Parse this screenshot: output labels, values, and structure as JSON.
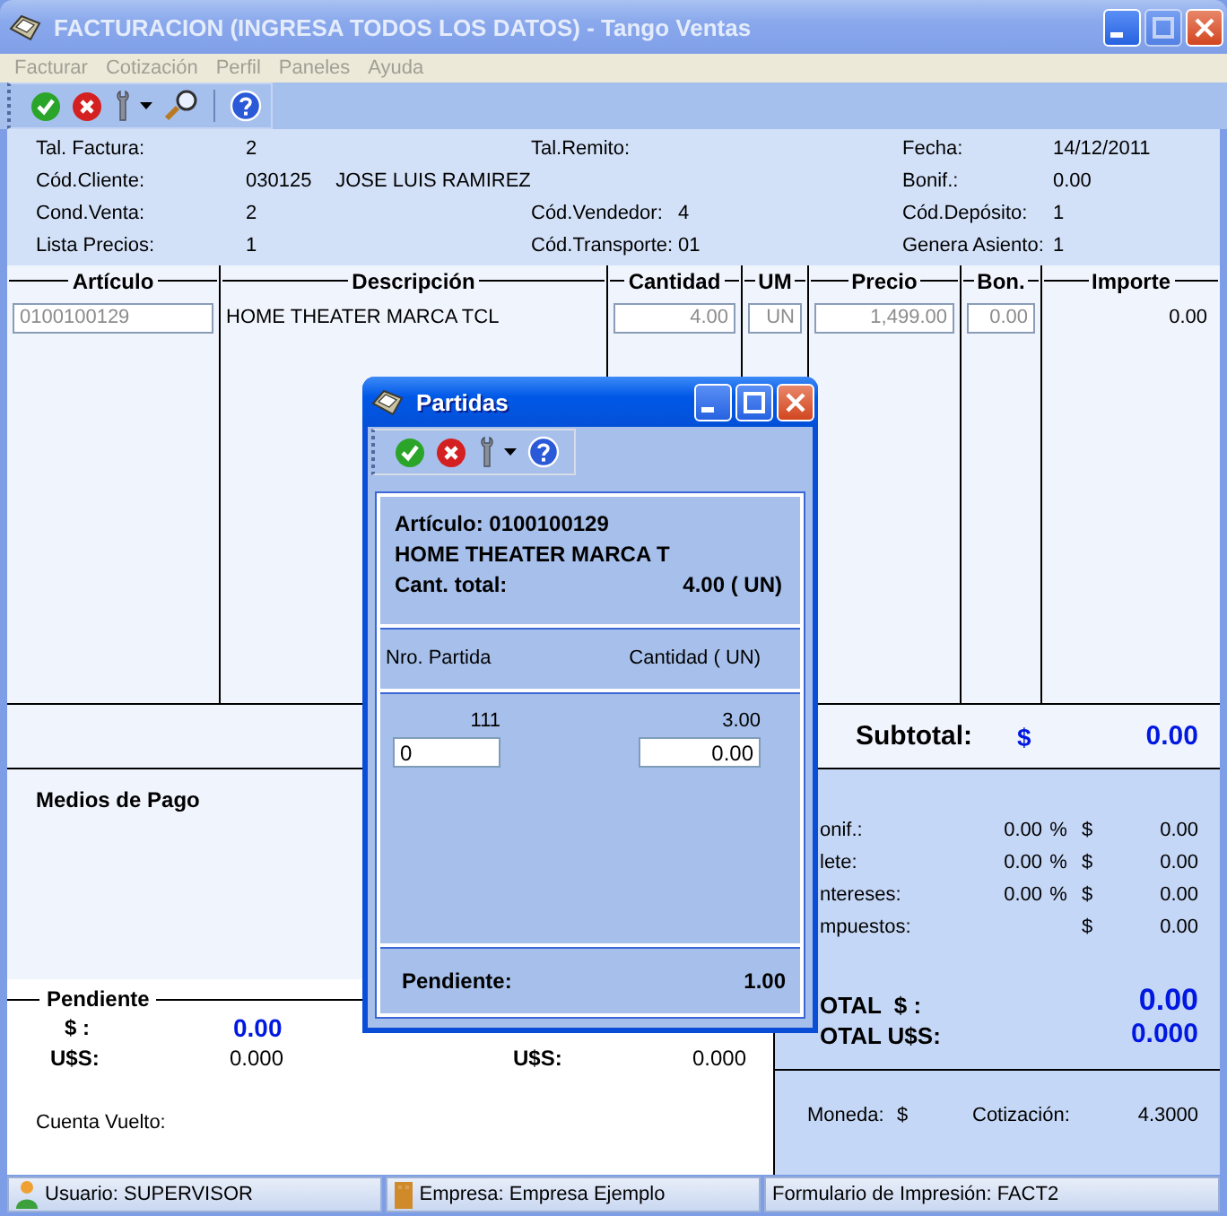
{
  "window": {
    "title": "FACTURACION (INGRESA TODOS LOS DATOS) - Tango Ventas",
    "active": false,
    "buttons": [
      {
        "kind": "minimize",
        "disabled": false
      },
      {
        "kind": "maximize",
        "disabled": true
      },
      {
        "kind": "close",
        "disabled": false
      }
    ]
  },
  "menu": [
    {
      "label": "Facturar",
      "disabled": true
    },
    {
      "label": "Cotización",
      "disabled": true
    },
    {
      "label": "Perfil",
      "disabled": true
    },
    {
      "label": "Paneles",
      "disabled": true
    },
    {
      "label": "Ayuda",
      "disabled": true
    }
  ],
  "header": {
    "rows": [
      [
        {
          "label": "Tal. Factura:",
          "value": "2"
        },
        {
          "label": "Tal.Remito:"
        },
        {
          "label": "Fecha:",
          "value": "14/12/2011"
        }
      ],
      [
        {
          "label": "Cód.Cliente:",
          "value": "030125",
          "extra": "JOSE LUIS RAMIREZ"
        },
        null,
        {
          "label": "Bonif.:",
          "value": "0.00"
        }
      ],
      [
        {
          "label": "Cond.Venta:",
          "value": "2"
        },
        {
          "label": "Cód.Vendedor:",
          "value": "4"
        },
        {
          "label": "Cód.Depósito:",
          "value": "1"
        }
      ],
      [
        {
          "label": "Lista Precios:",
          "value": "1"
        },
        {
          "label": "Cód.Transporte:",
          "value": "01"
        },
        {
          "label": "Genera Asiento:",
          "value": "1"
        }
      ]
    ]
  },
  "grid": {
    "columns": [
      "Artículo",
      "Descripción",
      "Cantidad",
      "UM",
      "Precio",
      "Bon.",
      "Importe"
    ],
    "rows": [
      {
        "cells": [
          {
            "kind": "field",
            "text": "0100100129",
            "disabled": true
          },
          {
            "kind": "text",
            "text": "HOME THEATER MARCA TCL"
          },
          {
            "kind": "field",
            "text": "4.00",
            "disabled": true
          },
          {
            "kind": "field",
            "text": "UN",
            "disabled": true
          },
          {
            "kind": "field",
            "text": "1,499.00",
            "disabled": true
          },
          {
            "kind": "field",
            "text": "0.00",
            "disabled": true
          },
          {
            "kind": "text",
            "text": "0.00"
          }
        ]
      }
    ]
  },
  "subtotal": {
    "label": "Subtotal:",
    "currency": "$",
    "value": "0.00"
  },
  "medios_de_pago": {
    "title": "Medios de Pago"
  },
  "pendiente": {
    "title": "Pendiente",
    "columns": [
      {
        "rows": [
          {
            "kind": "main",
            "label": "$ :",
            "value": "0.00"
          },
          {
            "kind": "plain",
            "label": "U$S:",
            "value": "0.000"
          }
        ]
      },
      {
        "rows": [
          {
            "kind": "plain",
            "label": "U$S:",
            "value": "0.000"
          }
        ]
      }
    ]
  },
  "cuenta_vuelto": {
    "label": "Cuenta Vuelto:"
  },
  "totals": {
    "rows": [
      {
        "label": "onif.:",
        "percent": "0.00",
        "percent_sign": "%",
        "currency": "$",
        "amount": "0.00"
      },
      {
        "label": "lete:",
        "percent": "0.00",
        "percent_sign": "%",
        "currency": "$",
        "amount": "0.00"
      },
      {
        "label": "ntereses:",
        "percent": "0.00",
        "percent_sign": "%",
        "currency": "$",
        "amount": "0.00"
      },
      {
        "label": "mpuestos:",
        "currency": "$",
        "amount": "0.00"
      }
    ],
    "total_pesos": {
      "label": "OTAL  $ :",
      "value": "0.00"
    },
    "total_dolares": {
      "label": "OTAL U$S:",
      "value": "0.000"
    }
  },
  "moneda": {
    "label": "Moneda:",
    "value": "$",
    "cotizacion_label": "Cotización:",
    "cotizacion": "4.3000"
  },
  "status_bar": [
    {
      "kind": "user",
      "text": "Usuario: SUPERVISOR"
    },
    {
      "kind": "company",
      "text": "Empresa: Empresa Ejemplo"
    },
    {
      "kind": "plain",
      "text": "Formulario de Impresión: FACT2"
    }
  ],
  "dialog": {
    "title": "Partidas",
    "active": true,
    "buttons": [
      {
        "kind": "minimize",
        "disabled": false
      },
      {
        "kind": "maximize",
        "disabled": false
      },
      {
        "kind": "close",
        "disabled": false
      }
    ],
    "articulo": "Artículo: 0100100129",
    "descripcion": "HOME THEATER MARCA T",
    "cant_label": "Cant. total:",
    "cant_value": "4.00 ( UN)",
    "columns": [
      "Nro. Partida",
      "Cantidad ( UN)"
    ],
    "rows": [
      {
        "nro": "111",
        "cantidad": "3.00"
      }
    ],
    "input": {
      "nro": "0",
      "cantidad": "0.00"
    },
    "pendiente_label": "Pendiente:",
    "pendiente_value": "1.00"
  }
}
